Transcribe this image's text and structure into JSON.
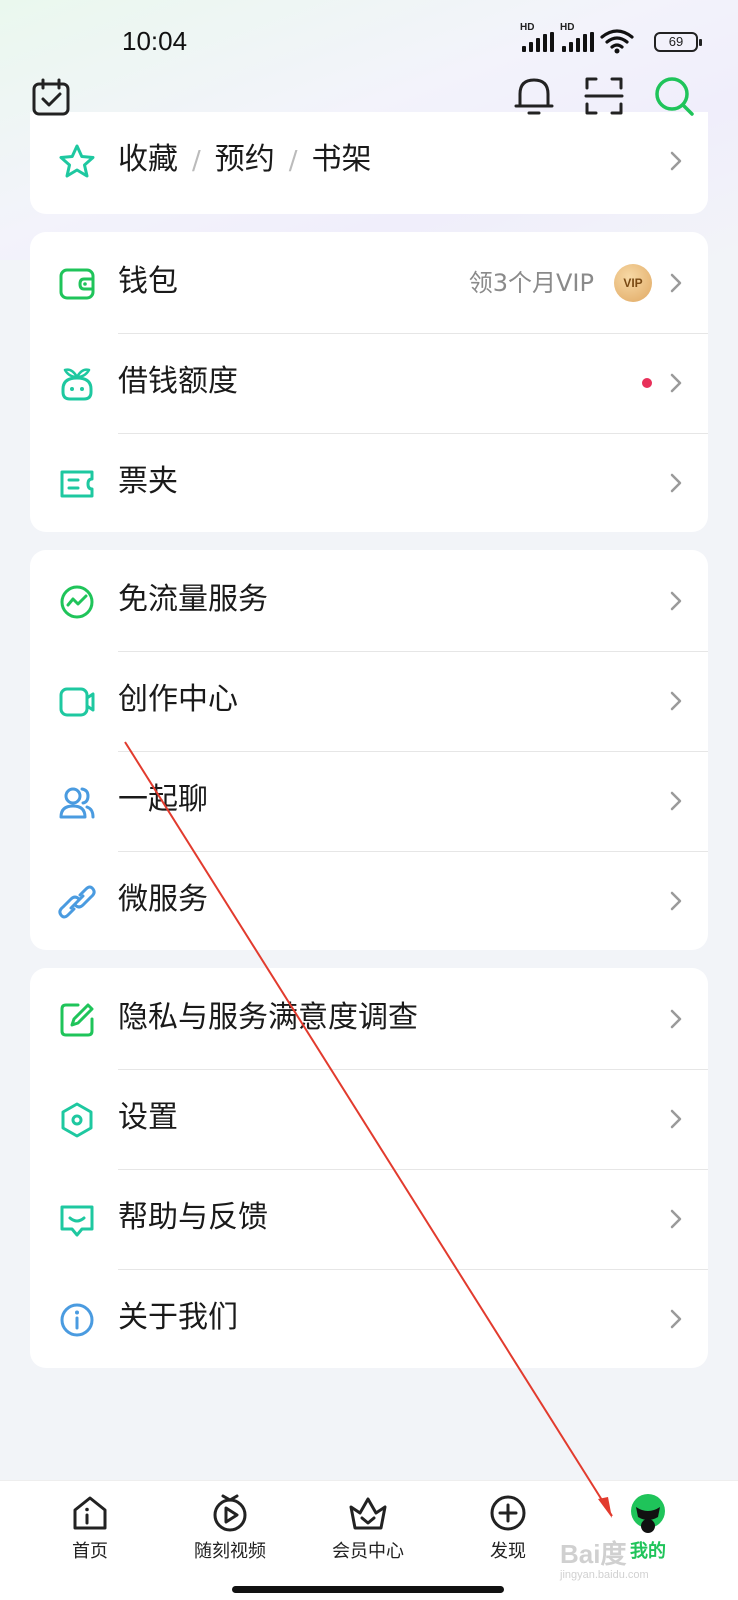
{
  "status_bar": {
    "time": "10:04",
    "signal_1_label": "HD",
    "signal_2_label": "HD",
    "battery": "69"
  },
  "header": {
    "icons": [
      "calendar-check-icon",
      "bell-icon",
      "scan-icon",
      "search-icon"
    ]
  },
  "top_card": {
    "items": [
      "收藏",
      "预约",
      "书架"
    ],
    "separator": "/"
  },
  "wallet_card": {
    "wallet": {
      "label": "钱包",
      "extra": "领3个月VIP",
      "badge": "VIP"
    },
    "loan": {
      "label": "借钱额度"
    },
    "tickets": {
      "label": "票夹"
    }
  },
  "services_card": {
    "items": [
      {
        "label": "免流量服务",
        "icon": "traffic-icon"
      },
      {
        "label": "创作中心",
        "icon": "video-camera-icon"
      },
      {
        "label": "一起聊",
        "icon": "people-icon"
      },
      {
        "label": "微服务",
        "icon": "link-icon"
      }
    ]
  },
  "settings_card": {
    "items": [
      {
        "label": "隐私与服务满意度调查",
        "icon": "edit-icon"
      },
      {
        "label": "设置",
        "icon": "hexagon-settings-icon"
      },
      {
        "label": "帮助与反馈",
        "icon": "feedback-icon"
      },
      {
        "label": "关于我们",
        "icon": "info-icon"
      }
    ]
  },
  "bottom_nav": {
    "items": [
      {
        "label": "首页",
        "icon": "home-icon"
      },
      {
        "label": "随刻视频",
        "icon": "play-icon"
      },
      {
        "label": "会员中心",
        "icon": "crown-basket-icon"
      },
      {
        "label": "发现",
        "icon": "plus-circle-icon"
      },
      {
        "label": "我的",
        "icon": "profile-avatar-icon",
        "active": true
      }
    ],
    "active_color": "#1fc45a"
  },
  "watermark": {
    "text": "Bai度",
    "sub": "jingyan.baidu.com"
  },
  "colors": {
    "accent_green": "#1fc45a",
    "icon_teal": "#1ec8a0",
    "icon_blue": "#4a9be0",
    "red_dot": "#e8305a"
  }
}
